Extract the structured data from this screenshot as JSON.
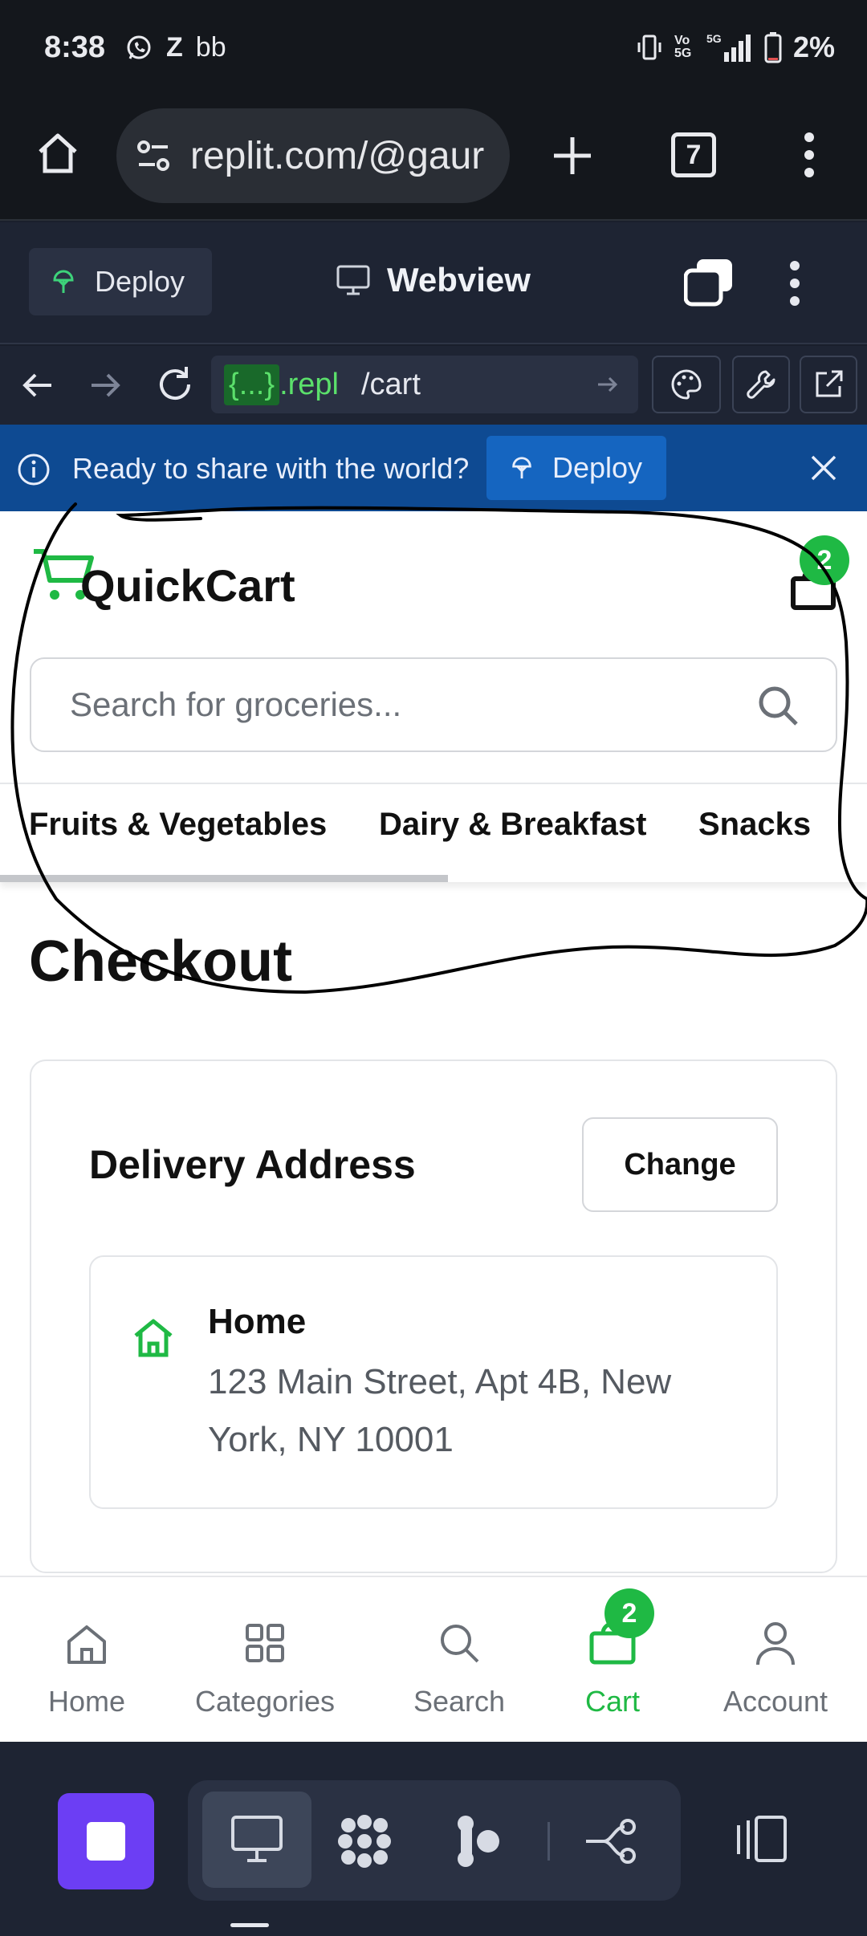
{
  "status_bar": {
    "time": "8:38",
    "notif_z": "Z",
    "notif_b": "bb",
    "battery": "2%",
    "icons": [
      "whatsapp-icon",
      "vibrate-icon",
      "volte-icon",
      "5g-signal-icon",
      "battery-icon"
    ]
  },
  "browser": {
    "url": "replit.com/@gaur",
    "tab_count": "7"
  },
  "replit_header": {
    "deploy_label": "Deploy",
    "webview_label": "Webview"
  },
  "replit_nav": {
    "repl_tag": "{...}",
    "repl_suffix": ".repl",
    "path": "/cart"
  },
  "banner": {
    "message": "Ready to share with the world?",
    "deploy_label": "Deploy"
  },
  "app": {
    "brand": "QuickCart",
    "cart_count": "2",
    "search_placeholder": "Search for groceries...",
    "categories": [
      "Fruits & Vegetables",
      "Dairy & Breakfast",
      "Snacks"
    ],
    "page_title": "Checkout",
    "delivery": {
      "title": "Delivery Address",
      "change_label": "Change",
      "address_name": "Home",
      "address_line": "123 Main Street, Apt 4B, New York, NY 10001"
    },
    "bottom_nav": {
      "items": [
        {
          "label": "Home",
          "icon": "home-icon"
        },
        {
          "label": "Categories",
          "icon": "grid-icon"
        },
        {
          "label": "Search",
          "icon": "search-icon"
        },
        {
          "label": "Cart",
          "icon": "cart-bag-icon"
        },
        {
          "label": "Account",
          "icon": "user-icon"
        }
      ],
      "active": "Cart",
      "cart_badge": "2"
    }
  },
  "colors": {
    "accent_green": "#1fb944",
    "banner_blue": "#0e4a92",
    "replit_dark": "#1e2433",
    "stop_purple": "#6c3ef4"
  }
}
